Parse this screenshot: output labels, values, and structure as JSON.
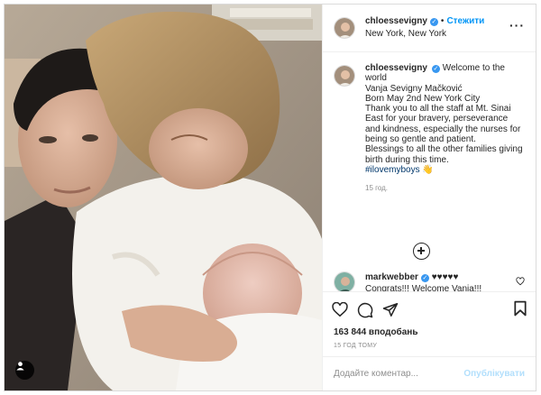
{
  "colors": {
    "accent": "#0095f6",
    "verified": "#3897f0",
    "post_disabled": "#b2dffc",
    "hashtag": "#00376b"
  },
  "header": {
    "username": "chloessevigny",
    "separator": "•",
    "follow_label": "Стежити",
    "location": "New York, New York",
    "more_icon": "more-horizontal-icon",
    "more_label": "···"
  },
  "caption": {
    "username": "chloessevigny",
    "lines": [
      "Welcome to the world",
      "Vanja Sevigny Mačković",
      "Born May 2nd New York City",
      "Thank you to all the staff at Mt. Sinai East for your bravery, perseverance and kindness, especially the nurses for being so gentle and patient.",
      "Blessings to all the other families giving birth during this time."
    ],
    "hashtag": "#ilovemyboys",
    "emoji": "👋",
    "time": "15 год."
  },
  "comments": [
    {
      "username": "markwebber",
      "badge_text": "♥♥♥♥♥",
      "text": "Congrats!!! Welcome Vanja!!!"
    }
  ],
  "actions": {
    "like_icon": "heart-icon",
    "comment_icon": "comment-icon",
    "share_icon": "share-icon",
    "save_icon": "bookmark-icon"
  },
  "likes": "163 844 вподобань",
  "date": "15 ГОД ТОМУ",
  "add_comment": {
    "placeholder": "Додайте коментар...",
    "post_label": "Опублікувати"
  }
}
